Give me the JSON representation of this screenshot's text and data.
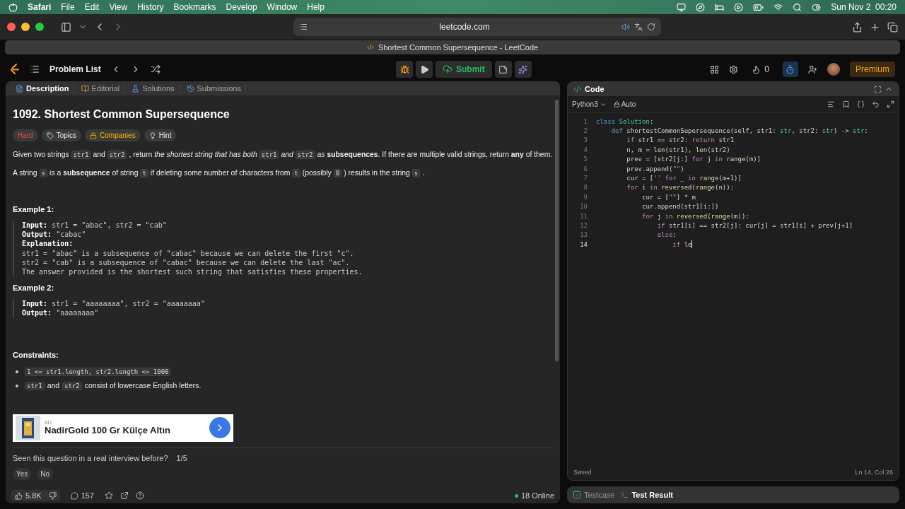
{
  "menu_bar": {
    "app": "Safari",
    "items": [
      "File",
      "Edit",
      "View",
      "History",
      "Bookmarks",
      "Develop",
      "Window",
      "Help"
    ],
    "clock": "Sun Nov 2  00:20"
  },
  "browser": {
    "address": "leetcode.com",
    "tab_title": "Shortest Common Supersequence - LeetCode"
  },
  "nav": {
    "problem_list": "Problem List",
    "submit": "Submit",
    "streak": "0",
    "premium": "Premium"
  },
  "left_tabs": [
    {
      "label": "Description",
      "selected": true
    },
    {
      "label": "Editorial",
      "selected": false
    },
    {
      "label": "Solutions",
      "selected": false
    },
    {
      "label": "Submissions",
      "selected": false
    }
  ],
  "problem": {
    "title": "1092. Shortest Common Supersequence",
    "difficulty": "Hard",
    "tags": [
      "Topics",
      "Companies",
      "Hint"
    ],
    "paragraphs": [
      [
        {
          "kind": "text",
          "text": "Given two strings"
        },
        {
          "kind": "code",
          "text": "str1"
        },
        {
          "kind": "text",
          "text": "and"
        },
        {
          "kind": "code",
          "text": "str2"
        },
        {
          "kind": "text",
          "text": ", return *the shortest string that has both*"
        },
        {
          "kind": "code",
          "text": "str1"
        },
        {
          "kind": "text",
          "text": "*and*"
        },
        {
          "kind": "code",
          "text": "str2"
        },
        {
          "kind": "text",
          "text": "*as* **subsequences**. If there are multiple valid strings, return **any** of them."
        }
      ],
      [
        {
          "kind": "text",
          "text": "A string"
        },
        {
          "kind": "code",
          "text": "s"
        },
        {
          "kind": "text",
          "text": "is a **subsequence** of string"
        },
        {
          "kind": "code",
          "text": "t"
        },
        {
          "kind": "text",
          "text": "if deleting some number of characters from"
        },
        {
          "kind": "code",
          "text": "t"
        },
        {
          "kind": "text",
          "text": "(possibly"
        },
        {
          "kind": "code",
          "text": "0"
        },
        {
          "kind": "text",
          "text": ") results in the string"
        },
        {
          "kind": "code",
          "text": "s"
        },
        {
          "kind": "text",
          "text": "."
        }
      ]
    ],
    "examples": [
      {
        "title": "Example 1:",
        "lines": [
          "**Input:** str1 = \"abac\", str2 = \"cab\"",
          "**Output:** \"cabac\"",
          "**Explanation:**",
          "str1 = \"abac\" is a subsequence of \"cabac\" because we can delete the first \"c\".",
          "str2 = \"cab\" is a subsequence of \"cabac\" because we can delete the last \"ac\".",
          "The answer provided is the shortest such string that satisfies these properties."
        ]
      },
      {
        "title": "Example 2:",
        "lines": [
          "**Input:** str1 = \"aaaaaaaa\", str2 = \"aaaaaaaa\"",
          "**Output:** \"aaaaaaaa\""
        ]
      }
    ],
    "constraints_title": "Constraints:",
    "constraints": [
      [
        {
          "kind": "code",
          "text": "1 <= str1.length, str2.length <= 1000"
        }
      ],
      [
        {
          "kind": "code",
          "text": "str1"
        },
        {
          "kind": "text",
          "text": "and"
        },
        {
          "kind": "code",
          "text": "str2"
        },
        {
          "kind": "text",
          "text": "consist of lowercase English letters."
        }
      ]
    ]
  },
  "ad": {
    "label": "AD",
    "text": "NadirGold 100 Gr Külçe Altın"
  },
  "interview": {
    "question": "Seen this question in a real interview before?",
    "count": "1/5",
    "answers": [
      "Yes",
      "No"
    ]
  },
  "footer": {
    "likes": "5.8K",
    "comments": "157",
    "online": "18 Online"
  },
  "code_panel": {
    "title": "Code",
    "language": "Python3",
    "mode": "Auto",
    "lines": [
      {
        "number": "1",
        "tokens": [
          {
            "kind": "decl",
            "text": "class"
          },
          {
            "kind": "type",
            "text": " Solution"
          },
          {
            "kind": "plain",
            "text": ":"
          }
        ]
      },
      {
        "number": "2",
        "tokens": [
          {
            "kind": "decl",
            "text": "    def"
          },
          {
            "kind": "plain",
            "text": " shortestCommonSupersequence(self, str1: "
          },
          {
            "kind": "type",
            "text": "str"
          },
          {
            "kind": "plain",
            "text": ", str2: "
          },
          {
            "kind": "type",
            "text": "str"
          },
          {
            "kind": "plain",
            "text": ") -> "
          },
          {
            "kind": "type",
            "text": "str"
          },
          {
            "kind": "plain",
            "text": ":"
          }
        ]
      },
      {
        "number": "3",
        "tokens": [
          {
            "kind": "ctrl",
            "text": "        if"
          },
          {
            "kind": "plain",
            "text": " str1 == str2: "
          },
          {
            "kind": "ctrl",
            "text": "return"
          },
          {
            "kind": "plain",
            "text": " str1"
          }
        ]
      },
      {
        "number": "4",
        "tokens": [
          {
            "kind": "plain",
            "text": "        n, m = "
          },
          {
            "kind": "fn",
            "text": "len"
          },
          {
            "kind": "plain",
            "text": "(str1), "
          },
          {
            "kind": "fn",
            "text": "len"
          },
          {
            "kind": "plain",
            "text": "(str2)"
          }
        ]
      },
      {
        "number": "5",
        "tokens": [
          {
            "kind": "plain",
            "text": "        prev = [str2[j:] "
          },
          {
            "kind": "ctrl",
            "text": "for"
          },
          {
            "kind": "plain",
            "text": " j "
          },
          {
            "kind": "ctrl",
            "text": "in"
          },
          {
            "kind": "fn",
            "text": " range"
          },
          {
            "kind": "plain",
            "text": "(m)]"
          }
        ]
      },
      {
        "number": "6",
        "tokens": [
          {
            "kind": "plain",
            "text": "        prev.append("
          },
          {
            "kind": "str",
            "text": "\"\""
          },
          {
            "kind": "plain",
            "text": ")"
          }
        ]
      },
      {
        "number": "7",
        "tokens": [
          {
            "kind": "plain",
            "text": "        cur = ["
          },
          {
            "kind": "str",
            "text": "''"
          },
          {
            "kind": "ctrl",
            "text": " for"
          },
          {
            "kind": "plain",
            "text": " _ "
          },
          {
            "kind": "ctrl",
            "text": "in"
          },
          {
            "kind": "fn",
            "text": " range"
          },
          {
            "kind": "plain",
            "text": "(m+1)]"
          }
        ]
      },
      {
        "number": "8",
        "tokens": [
          {
            "kind": "ctrl",
            "text": "        for"
          },
          {
            "kind": "plain",
            "text": " i "
          },
          {
            "kind": "ctrl",
            "text": "in"
          },
          {
            "kind": "fn",
            "text": " reversed"
          },
          {
            "kind": "plain",
            "text": "("
          },
          {
            "kind": "fn",
            "text": "range"
          },
          {
            "kind": "plain",
            "text": "(n)):"
          }
        ]
      },
      {
        "number": "9",
        "tokens": [
          {
            "kind": "plain",
            "text": "            cur = ["
          },
          {
            "kind": "str",
            "text": "\"\""
          },
          {
            "kind": "plain",
            "text": "] * m"
          }
        ]
      },
      {
        "number": "10",
        "tokens": [
          {
            "kind": "plain",
            "text": "            cur.append(str1[i:])"
          }
        ]
      },
      {
        "number": "11",
        "tokens": [
          {
            "kind": "ctrl",
            "text": "            for"
          },
          {
            "kind": "plain",
            "text": " j "
          },
          {
            "kind": "ctrl",
            "text": "in"
          },
          {
            "kind": "fn",
            "text": " reversed"
          },
          {
            "kind": "plain",
            "text": "("
          },
          {
            "kind": "fn",
            "text": "range"
          },
          {
            "kind": "plain",
            "text": "(m)):"
          }
        ]
      },
      {
        "number": "12",
        "tokens": [
          {
            "kind": "ctrl",
            "text": "                if"
          },
          {
            "kind": "plain",
            "text": " str1[i] == str2[j]: cur[j] = str1[i] + prev[j+1]"
          }
        ]
      },
      {
        "number": "13",
        "tokens": [
          {
            "kind": "ctrl",
            "text": "                else"
          },
          {
            "kind": "plain",
            "text": ":"
          }
        ]
      },
      {
        "number": "14",
        "tokens": [
          {
            "kind": "ctrl",
            "text": "                    if"
          },
          {
            "kind": "plain",
            "text": " le"
          }
        ]
      }
    ],
    "status": "Saved",
    "position": "Ln 14, Col 26"
  },
  "bottom_tabs": [
    {
      "label": "Testcase",
      "selected": false
    },
    {
      "label": "Test Result",
      "selected": true
    }
  ]
}
